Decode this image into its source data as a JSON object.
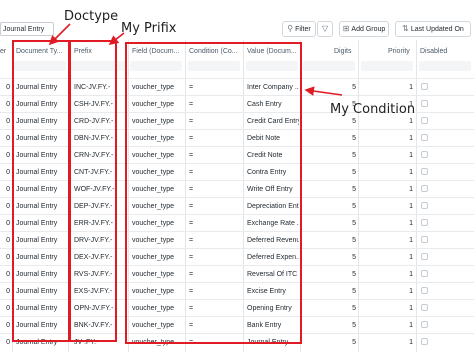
{
  "toolbar": {
    "filter_value": "Journal Entry",
    "filter_button": "Filter",
    "add_group_button": "Add Group",
    "sort_button": "Last Updated On"
  },
  "columns": [
    "er",
    "Document Ty...",
    "Prefix",
    "Field (Docum...",
    "Condition (Co...",
    "Value (Docum...",
    "Digits",
    "Priority",
    "Disabled"
  ],
  "rows": [
    {
      "n": "0",
      "doctype": "Journal Entry",
      "prefix": "INC-JV.FY.-",
      "field": "voucher_type",
      "cond": "=",
      "value": "Inter Company ...",
      "digits": "5",
      "priority": "1"
    },
    {
      "n": "0",
      "doctype": "Journal Entry",
      "prefix": "CSH-JV.FY.-",
      "field": "voucher_type",
      "cond": "=",
      "value": "Cash Entry",
      "digits": "5",
      "priority": "1"
    },
    {
      "n": "0",
      "doctype": "Journal Entry",
      "prefix": "CRD-JV.FY.-",
      "field": "voucher_type",
      "cond": "=",
      "value": "Credit Card Entry",
      "digits": "5",
      "priority": "1"
    },
    {
      "n": "0",
      "doctype": "Journal Entry",
      "prefix": "DBN-JV.FY.-",
      "field": "voucher_type",
      "cond": "=",
      "value": "Debit Note",
      "digits": "5",
      "priority": "1"
    },
    {
      "n": "0",
      "doctype": "Journal Entry",
      "prefix": "CRN-JV.FY.-",
      "field": "voucher_type",
      "cond": "=",
      "value": "Credit Note",
      "digits": "5",
      "priority": "1"
    },
    {
      "n": "0",
      "doctype": "Journal Entry",
      "prefix": "CNT-JV.FY.-",
      "field": "voucher_type",
      "cond": "=",
      "value": "Contra Entry",
      "digits": "5",
      "priority": "1"
    },
    {
      "n": "0",
      "doctype": "Journal Entry",
      "prefix": "WOF-JV.FY.-",
      "field": "voucher_type",
      "cond": "=",
      "value": "Write Off Entry",
      "digits": "5",
      "priority": "1"
    },
    {
      "n": "0",
      "doctype": "Journal Entry",
      "prefix": "DEP-JV.FY.-",
      "field": "voucher_type",
      "cond": "=",
      "value": "Depreciation Ent...",
      "digits": "5",
      "priority": "1"
    },
    {
      "n": "0",
      "doctype": "Journal Entry",
      "prefix": "ERR-JV.FY.-",
      "field": "voucher_type",
      "cond": "=",
      "value": "Exchange Rate ...",
      "digits": "5",
      "priority": "1"
    },
    {
      "n": "0",
      "doctype": "Journal Entry",
      "prefix": "DRV-JV.FY.-",
      "field": "voucher_type",
      "cond": "=",
      "value": "Deferred Revenu...",
      "digits": "5",
      "priority": "1"
    },
    {
      "n": "0",
      "doctype": "Journal Entry",
      "prefix": "DEX-JV.FY.-",
      "field": "voucher_type",
      "cond": "=",
      "value": "Deferred Expen...",
      "digits": "5",
      "priority": "1"
    },
    {
      "n": "0",
      "doctype": "Journal Entry",
      "prefix": "RVS-JV.FY.-",
      "field": "voucher_type",
      "cond": "=",
      "value": "Reversal Of ITC",
      "digits": "5",
      "priority": "1"
    },
    {
      "n": "0",
      "doctype": "Journal Entry",
      "prefix": "EXS-JV.FY.-",
      "field": "voucher_type",
      "cond": "=",
      "value": "Excise Entry",
      "digits": "5",
      "priority": "1"
    },
    {
      "n": "0",
      "doctype": "Journal Entry",
      "prefix": "OPN-JV.FY.-",
      "field": "voucher_type",
      "cond": "=",
      "value": "Opening Entry",
      "digits": "5",
      "priority": "1"
    },
    {
      "n": "0",
      "doctype": "Journal Entry",
      "prefix": "BNK-JV.FY.-",
      "field": "voucher_type",
      "cond": "=",
      "value": "Bank Entry",
      "digits": "5",
      "priority": "1"
    },
    {
      "n": "0",
      "doctype": "Journal Entry",
      "prefix": "JV-.FY.-",
      "field": "voucher_type",
      "cond": "=",
      "value": "Journal Entry",
      "digits": "5",
      "priority": "1"
    }
  ],
  "annotations": {
    "doctype": "Doctype",
    "prefix": "My Prifix",
    "condition": "My Condition"
  },
  "colors": {
    "highlight": "#e01b24",
    "grid_line": "#e2e6e9"
  },
  "icons": [
    "filter-icon",
    "funnel-icon",
    "add-group-icon",
    "sort-icon"
  ]
}
